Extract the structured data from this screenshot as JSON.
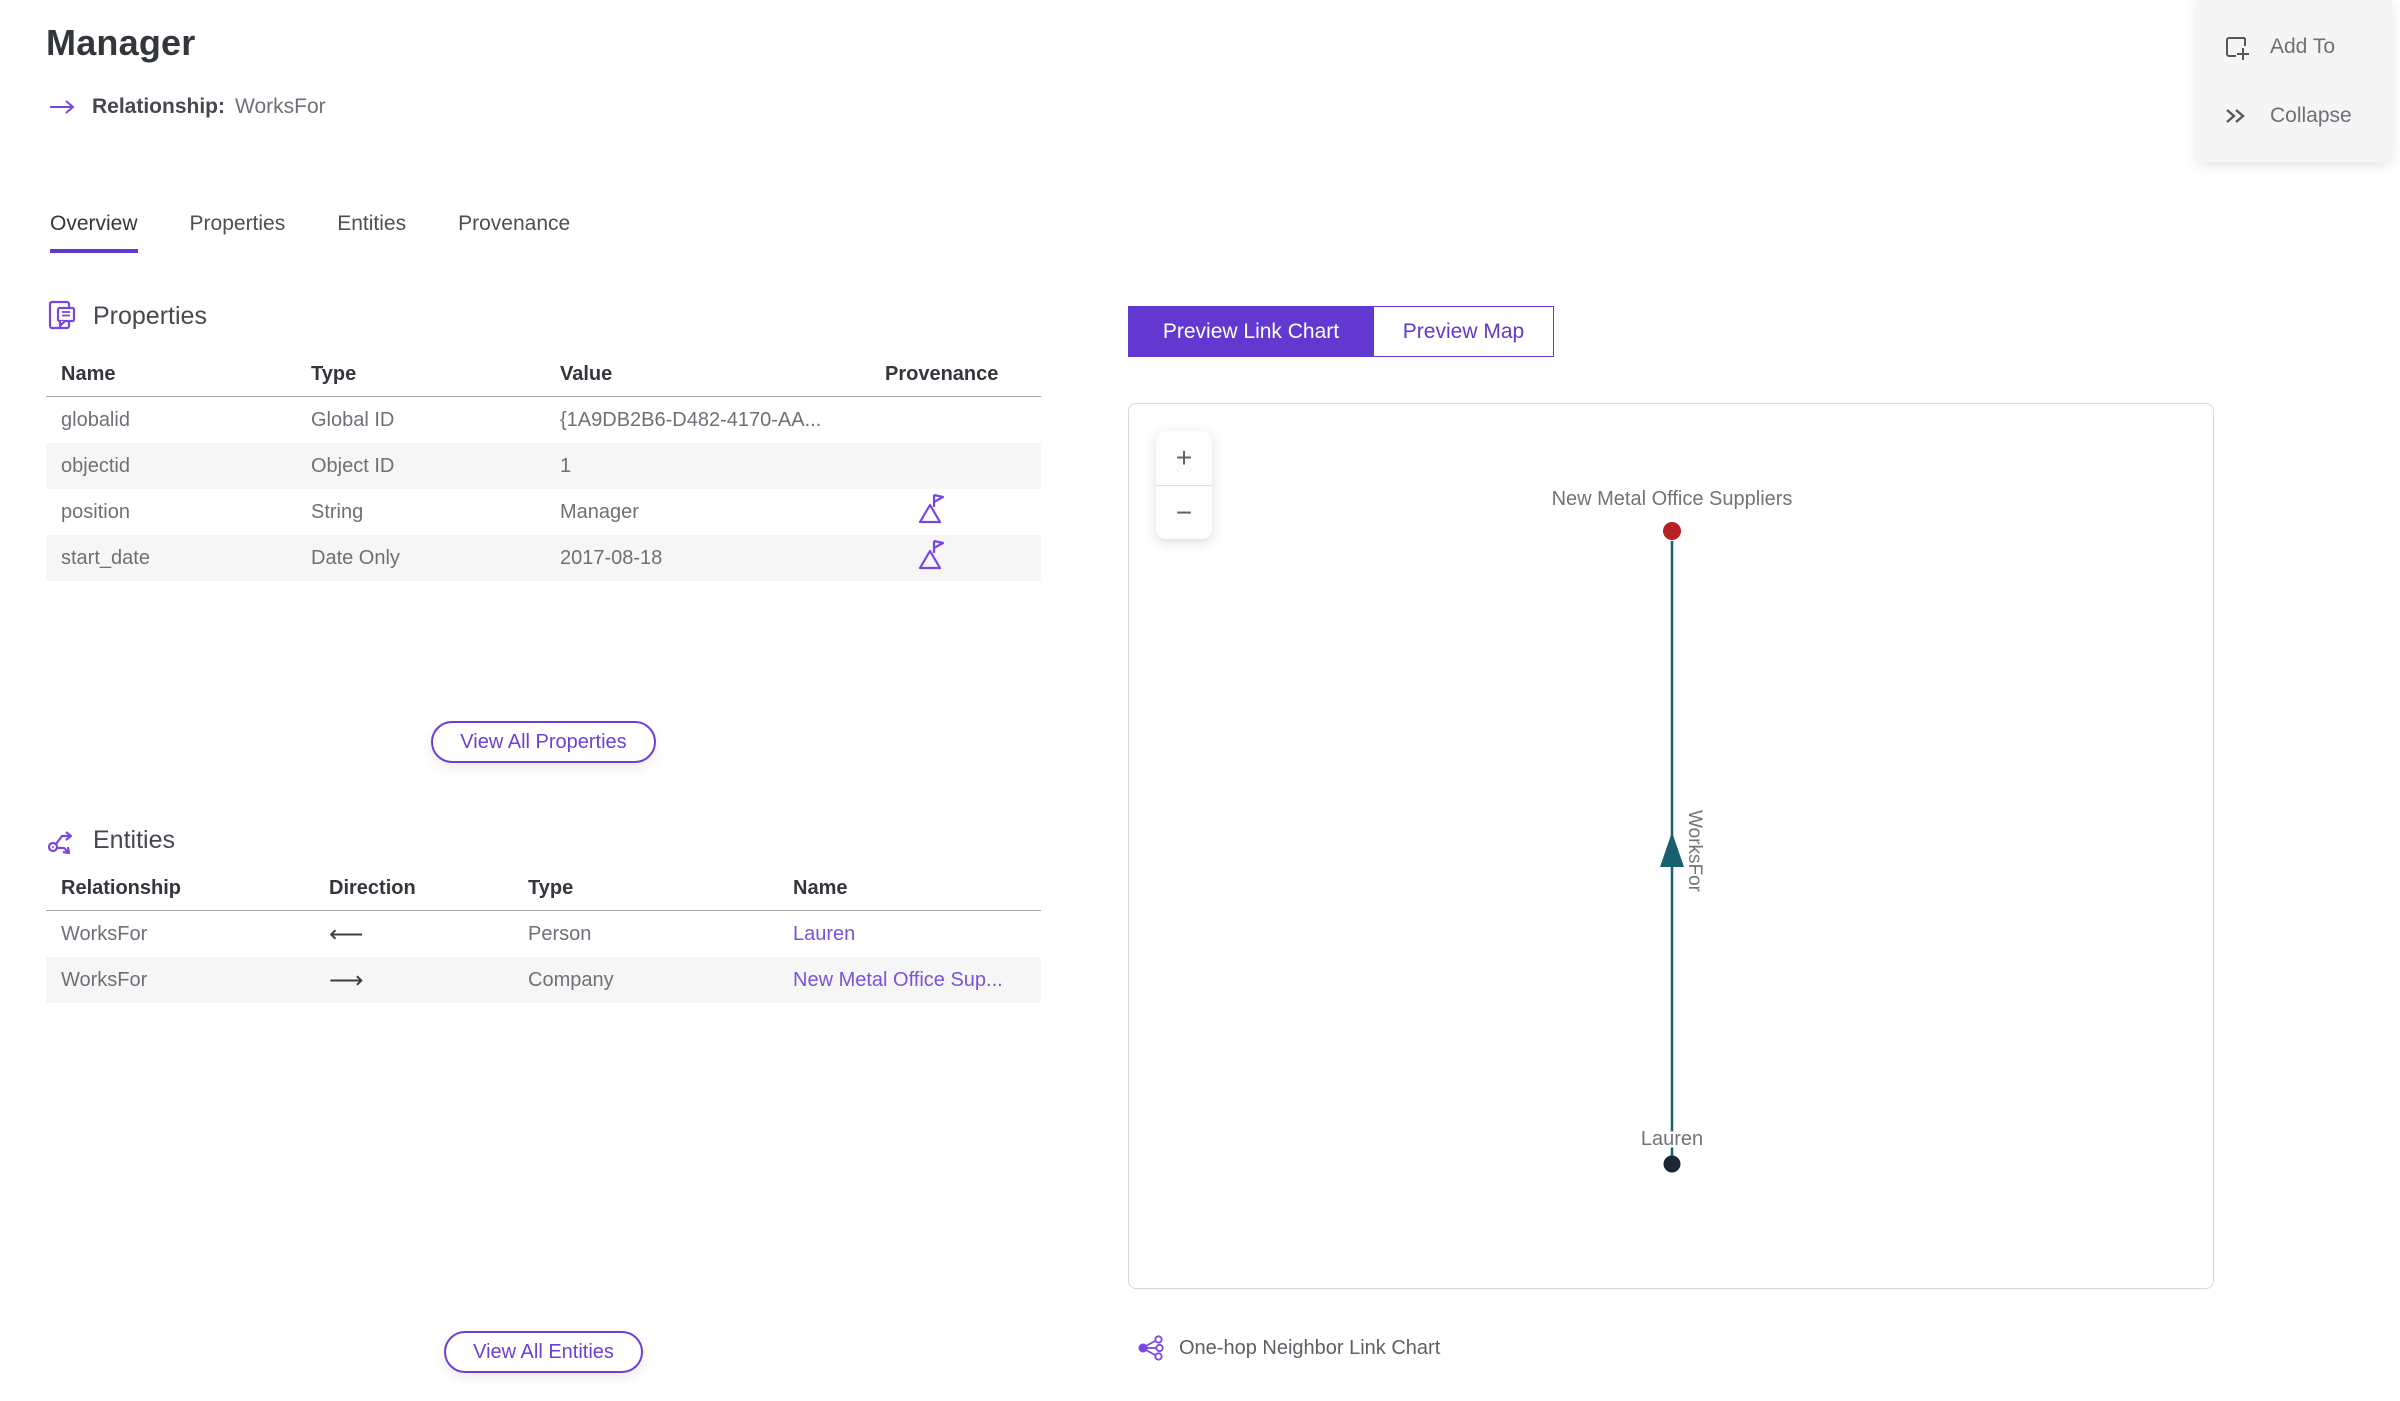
{
  "header": {
    "title": "Manager",
    "relationship_label": "Relationship:",
    "relationship_value": "WorksFor"
  },
  "toolbar": {
    "add_to": "Add To",
    "collapse": "Collapse"
  },
  "tabs": [
    {
      "label": "Overview",
      "active": true
    },
    {
      "label": "Properties",
      "active": false
    },
    {
      "label": "Entities",
      "active": false
    },
    {
      "label": "Provenance",
      "active": false
    }
  ],
  "properties_section": {
    "title": "Properties",
    "view_all_label": "View All Properties",
    "columns": [
      "Name",
      "Type",
      "Value",
      "Provenance"
    ],
    "rows": [
      {
        "name": "globalid",
        "type": "Global ID",
        "value": "{1A9DB2B6-D482-4170-AA...",
        "has_provenance_flag": false
      },
      {
        "name": "objectid",
        "type": "Object ID",
        "value": "1",
        "has_provenance_flag": false
      },
      {
        "name": "position",
        "type": "String",
        "value": "Manager",
        "has_provenance_flag": true
      },
      {
        "name": "start_date",
        "type": "Date Only",
        "value": "2017-08-18",
        "has_provenance_flag": true
      }
    ]
  },
  "entities_section": {
    "title": "Entities",
    "view_all_label": "View All Entities",
    "columns": [
      "Relationship",
      "Direction",
      "Type",
      "Name"
    ],
    "rows": [
      {
        "relationship": "WorksFor",
        "direction": "⟵",
        "type": "Person",
        "name": "Lauren"
      },
      {
        "relationship": "WorksFor",
        "direction": "⟶",
        "type": "Company",
        "name": "New Metal Office Sup..."
      }
    ]
  },
  "preview": {
    "link_chart_tab": "Preview Link Chart",
    "map_tab": "Preview Map",
    "active_tab": "Preview Link Chart",
    "zoom_in": "+",
    "zoom_out": "−",
    "caption": "One-hop Neighbor Link Chart"
  },
  "chart_data": {
    "type": "link-chart",
    "nodes": [
      {
        "id": "company",
        "label": "New Metal Office Suppliers",
        "color": "#b92025",
        "position": "top"
      },
      {
        "id": "person",
        "label": "Lauren",
        "color": "#1c2733",
        "position": "bottom"
      }
    ],
    "edges": [
      {
        "from": "person",
        "to": "company",
        "label": "WorksFor",
        "color": "#19606f",
        "arrow": "up"
      }
    ]
  },
  "colors": {
    "accent": "#6139d1",
    "icon_purple": "#7747e3",
    "link": "#7a52d9",
    "node_red": "#b92025",
    "node_navy": "#1c2733",
    "edge_teal": "#19606f"
  }
}
